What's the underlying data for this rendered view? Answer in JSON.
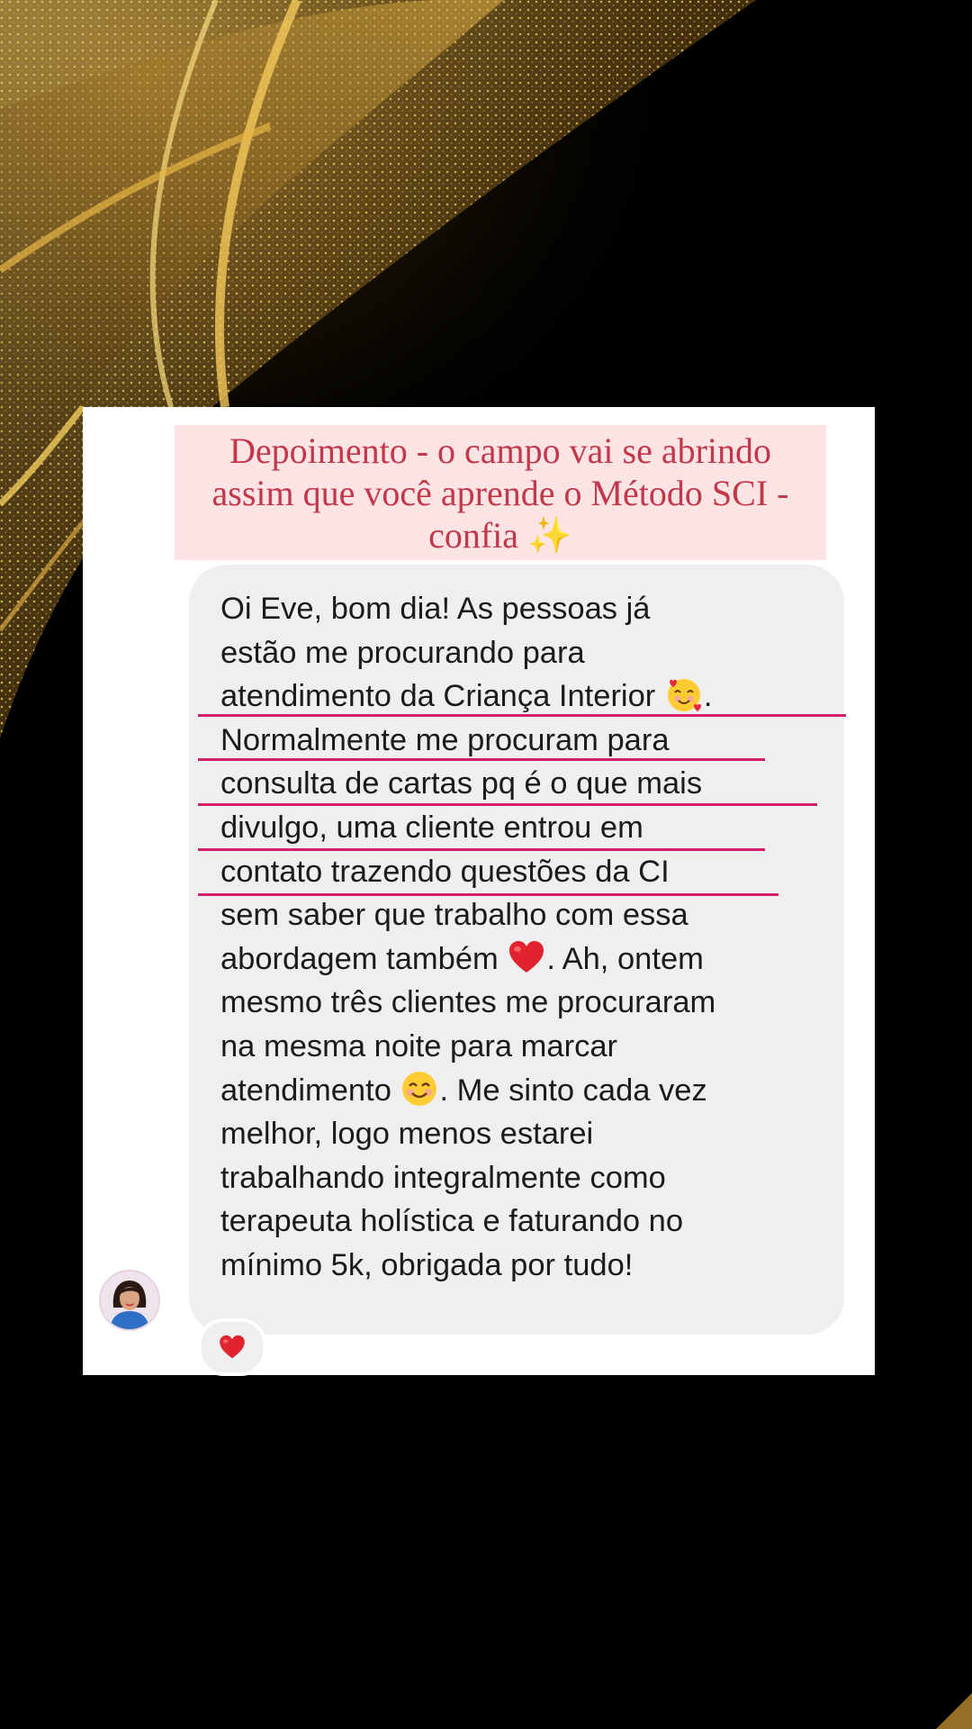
{
  "card": {
    "title_lines": [
      "Depoimento - o campo vai se abrindo",
      "assim que você aprende o Método SCI -",
      "confia"
    ],
    "title_emoji": "✨"
  },
  "message": {
    "lines": [
      "Oi Eve, bom dia! As pessoas já",
      "estão me procurando para",
      "atendimento da Criança Interior",
      "Normalmente me procuram para",
      "consulta de cartas pq é o que mais",
      "divulgo, uma cliente entrou em",
      "contato trazendo questões da CI",
      "sem saber que trabalho com essa",
      "abordagem também",
      "mesmo três clientes me procuraram",
      "na mesma noite para marcar",
      "atendimento",
      "melhor, logo menos estarei",
      "trabalhando integralmente como",
      "terapeuta holística e faturando no",
      "mínimo 5k, obrigada por tudo!"
    ],
    "line3_suffix": ".",
    "line9_suffix": ". Ah, ontem",
    "line12_suffix": ". Me sinto cada vez",
    "emojis": [
      "smiling-face-with-hearts",
      "red-heart",
      "smiling-face-with-smiling-eyes"
    ],
    "highlight_color": "#d31f6c"
  },
  "reaction": {
    "emoji": "red-heart"
  },
  "colors": {
    "background": "#000000",
    "gold": "#d4a640",
    "title_text": "#c2384a",
    "title_bg": "#fce4e4",
    "bubble": "#efefef"
  }
}
